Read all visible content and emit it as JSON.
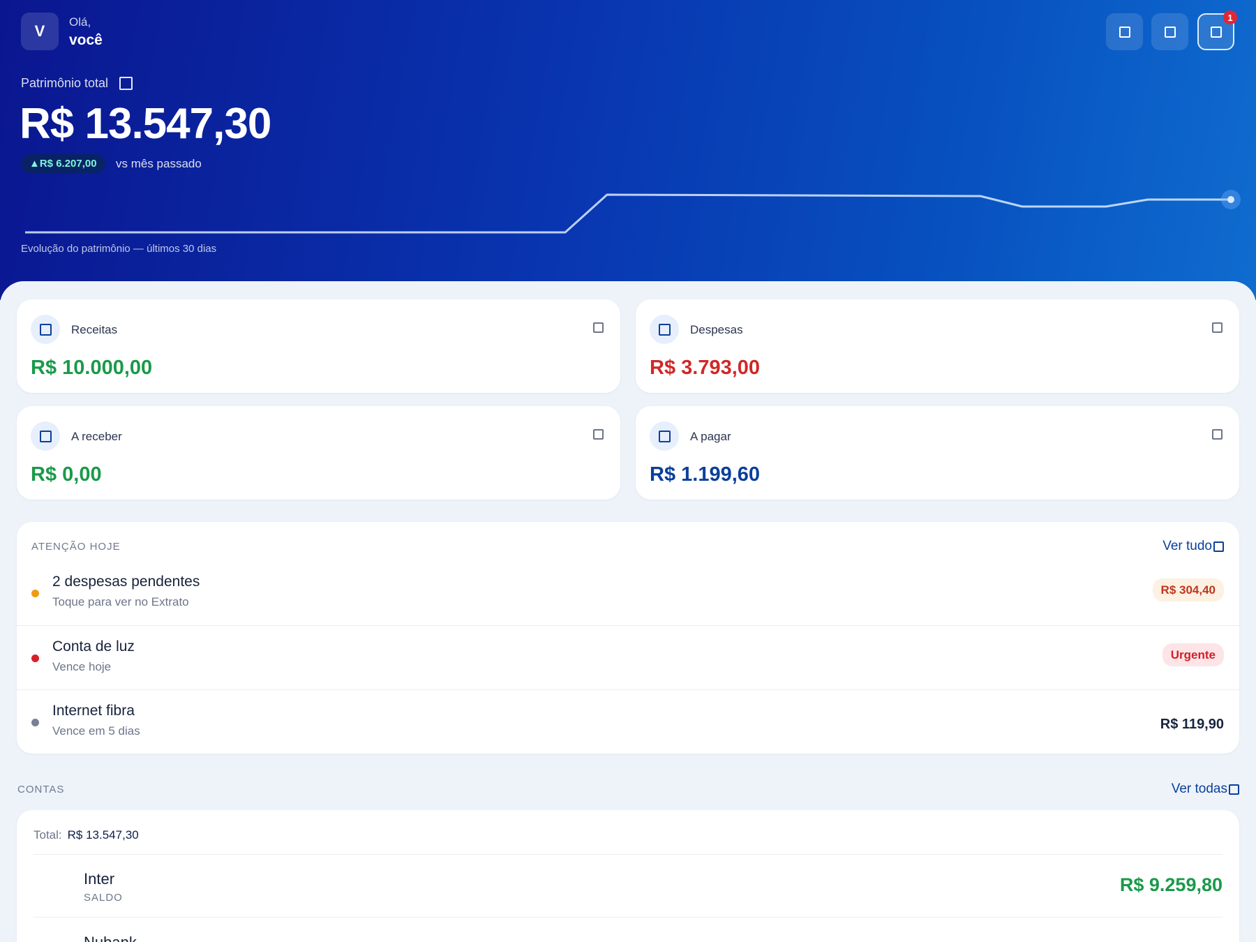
{
  "header": {
    "avatar_letter": "V",
    "greeting": "Olá,",
    "user_name": "você",
    "notification_count": "1",
    "actions": [
      {
        "name": "header-action-1-icon"
      },
      {
        "name": "header-action-2-icon"
      },
      {
        "name": "notifications-icon"
      }
    ]
  },
  "patrimonio": {
    "label": "Patrimônio total",
    "value": "R$ 13.547,30",
    "delta": "▲R$ 6.207,00",
    "delta_caption": "vs mês passado",
    "chart_caption": "Evolução do patrimônio — últimos 30 dias"
  },
  "stats": [
    {
      "label": "Receitas",
      "value": "R$ 10.000,00",
      "color": "#1a9a4a"
    },
    {
      "label": "Despesas",
      "value": "R$ 3.793,00",
      "color": "#d02828"
    },
    {
      "label": "A receber",
      "value": "R$ 0,00",
      "color": "#1a9a4a"
    },
    {
      "label": "A pagar",
      "value": "R$ 1.199,60",
      "color": "#0a3f9b"
    }
  ],
  "attention": {
    "title": "ATENÇÃO HOJE",
    "link": "Ver tudo",
    "items": [
      {
        "title": "2 despesas pendentes",
        "subtitle": "Toque para ver no Extrato",
        "right": "R$ 304,40",
        "dot_color": "#f29a14"
      },
      {
        "title": "Conta de luz",
        "subtitle": "Vence hoje",
        "right": "Urgente",
        "dot_color": "#d8202a"
      },
      {
        "title": "Internet fibra",
        "subtitle": "Vence em 5 dias",
        "right": "R$ 119,90",
        "dot_color": "#7a7f95"
      }
    ]
  },
  "contas": {
    "title": "CONTAS",
    "link": "Ver todas",
    "total_label": "Total:",
    "total_value": "R$ 13.547,30",
    "accounts": [
      {
        "name": "Inter",
        "type": "SALDO",
        "value": "R$ 9.259,80"
      },
      {
        "name": "Nubank",
        "type": "",
        "value": ""
      }
    ]
  },
  "colors": {
    "primary": "#0a3f9b",
    "income": "#1a9a4a",
    "expense": "#d02828",
    "hero_start": "#0a1690",
    "hero_end": "#0f6ccf"
  }
}
